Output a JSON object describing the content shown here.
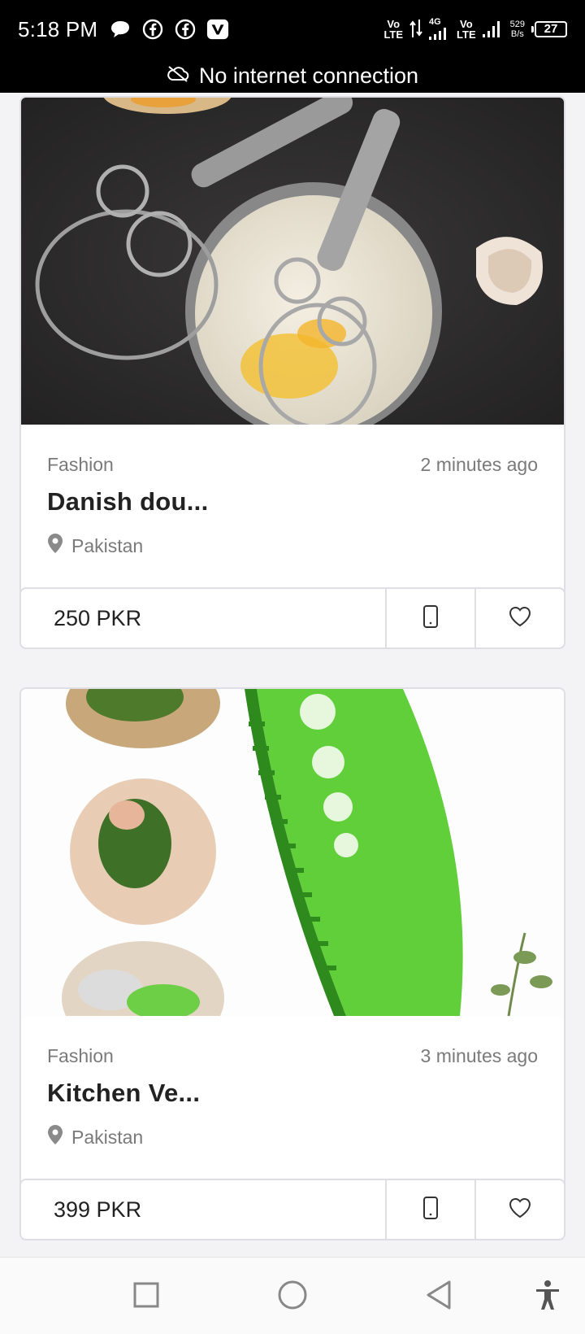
{
  "status_bar": {
    "time": "5:18 PM",
    "net1": "Vo",
    "net1b": "LTE",
    "net_4g": "4G",
    "net2": "Vo",
    "net2b": "LTE",
    "speed_value": "529",
    "speed_unit": "B/s",
    "battery": "27"
  },
  "offline_banner": {
    "text": "No internet connection",
    "icon": "cloud-off-icon"
  },
  "listings": [
    {
      "category": "Fashion",
      "time": "2 minutes ago",
      "title": "Danish dou...",
      "location": "Pakistan",
      "price": "250 PKR"
    },
    {
      "category": "Fashion",
      "time": "3 minutes ago",
      "title": "Kitchen Ve...",
      "location": "Pakistan",
      "price": "399 PKR"
    }
  ],
  "nav": {
    "icons": [
      "recents-square-icon",
      "home-circle-icon",
      "back-triangle-icon",
      "accessibility-icon"
    ]
  },
  "colors": {
    "accent_green": "#5fd33a",
    "muted_text": "#7a7a7a",
    "border": "#dedee4"
  }
}
